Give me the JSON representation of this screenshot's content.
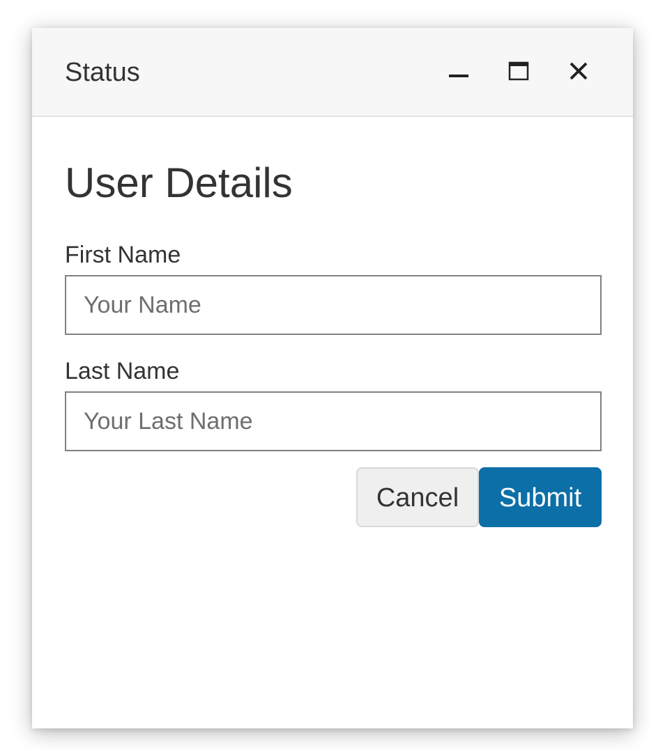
{
  "window": {
    "title": "Status",
    "controls": {
      "minimize_icon": "minimize-icon",
      "maximize_icon": "maximize-icon",
      "close_icon": "close-icon"
    }
  },
  "form": {
    "heading": "User Details",
    "first_name": {
      "label": "First Name",
      "value": "",
      "placeholder": "Your Name"
    },
    "last_name": {
      "label": "Last Name",
      "value": "",
      "placeholder": "Your Last Name"
    },
    "cancel_label": "Cancel",
    "submit_label": "Submit"
  },
  "colors": {
    "accent": "#0c6fa8",
    "text": "#333333",
    "titlebar_bg": "#f7f7f7"
  }
}
